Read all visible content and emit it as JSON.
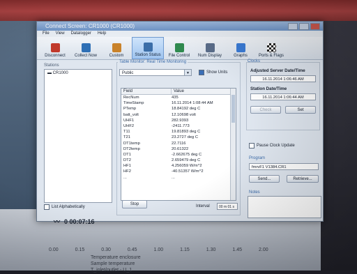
{
  "window": {
    "title": "Connect Screen: CR1000 (CR1000)"
  },
  "menu": [
    "File",
    "View",
    "Datalogger",
    "Help"
  ],
  "toolbar": [
    {
      "label": "Disconnect",
      "icon": "disconnect-icon",
      "color": "#c0392b"
    },
    {
      "label": "Collect Now",
      "icon": "collect-icon",
      "color": "#2e6fb5"
    },
    {
      "label": "Custom",
      "icon": "custom-icon",
      "color": "#c9822a"
    },
    {
      "label": "Station Status",
      "icon": "station-status-icon",
      "color": "#3b6ea8"
    },
    {
      "label": "File Control",
      "icon": "file-control-icon",
      "color": "#2f8a4f"
    },
    {
      "label": "Num Display",
      "icon": "num-display-icon",
      "color": "#5a6d8a"
    },
    {
      "label": "Graphs",
      "icon": "graphs-icon",
      "color": "#3a7bd5"
    },
    {
      "label": "Ports & Flags",
      "icon": "flags-icon",
      "color": "#222222"
    }
  ],
  "stations": {
    "label": "Stations",
    "items": [
      "CR1000"
    ],
    "list_alpha": "List Alphabetically",
    "elapsed": "0 00:07:16"
  },
  "table_monitor": {
    "title": "Table Monitor: Real Time Monitoring",
    "table": "Public",
    "show_units": "Show Units",
    "columns": [
      "Field",
      "Value"
    ],
    "rows": [
      [
        "RecNum",
        "435"
      ],
      [
        "TimeStamp",
        "16.11.2014 1:08:44 AM"
      ],
      [
        "PTemp",
        "18.84192 deg C"
      ],
      [
        "batt_volt",
        "12.10698 volt"
      ],
      [
        "UHF1",
        "282.9393"
      ],
      [
        "UHF2",
        "-2411.773"
      ],
      [
        "T11",
        "19.81893 deg C"
      ],
      [
        "T21",
        "23.2727 deg C"
      ],
      [
        "DT1temp",
        "22.7116"
      ],
      [
        "DT2temp",
        "20.61322"
      ],
      [
        "DT1",
        "-2.662675 deg C"
      ],
      [
        "DT2",
        "2.659479 deg C"
      ],
      [
        "HF1",
        "4.256059 W/m^2"
      ],
      [
        "HF2",
        "-40.51357 W/m^2"
      ],
      [
        "...",
        "..."
      ]
    ],
    "stop": "Stop",
    "interval_label": "Interval",
    "interval": "00 m 01 s"
  },
  "clocks": {
    "title": "Clocks",
    "adjusted_label": "Adjusted Server Date/Time",
    "adjusted_value": "16.11.2014 1:06:46 AM",
    "station_label": "Station Date/Time",
    "station_value": "16.11.2014 1:06:44 AM",
    "check": "Check",
    "set": "Set",
    "pause": "Pause Clock Update"
  },
  "program": {
    "title": "Program",
    "file": "fmrvF1 V1384.CR1",
    "send": "Send...",
    "retrieve": "Retrieve..."
  },
  "notes": {
    "title": "Notes"
  },
  "background_graph": {
    "ticks": [
      "0.00",
      "0.15",
      "0.30",
      "0.45",
      "1.00",
      "1.15",
      "1.30",
      "1.45",
      "2.00"
    ],
    "legend": [
      "Temperature enclosure",
      "Sample temperature",
      "T_inlet/outlet - U_1"
    ]
  }
}
